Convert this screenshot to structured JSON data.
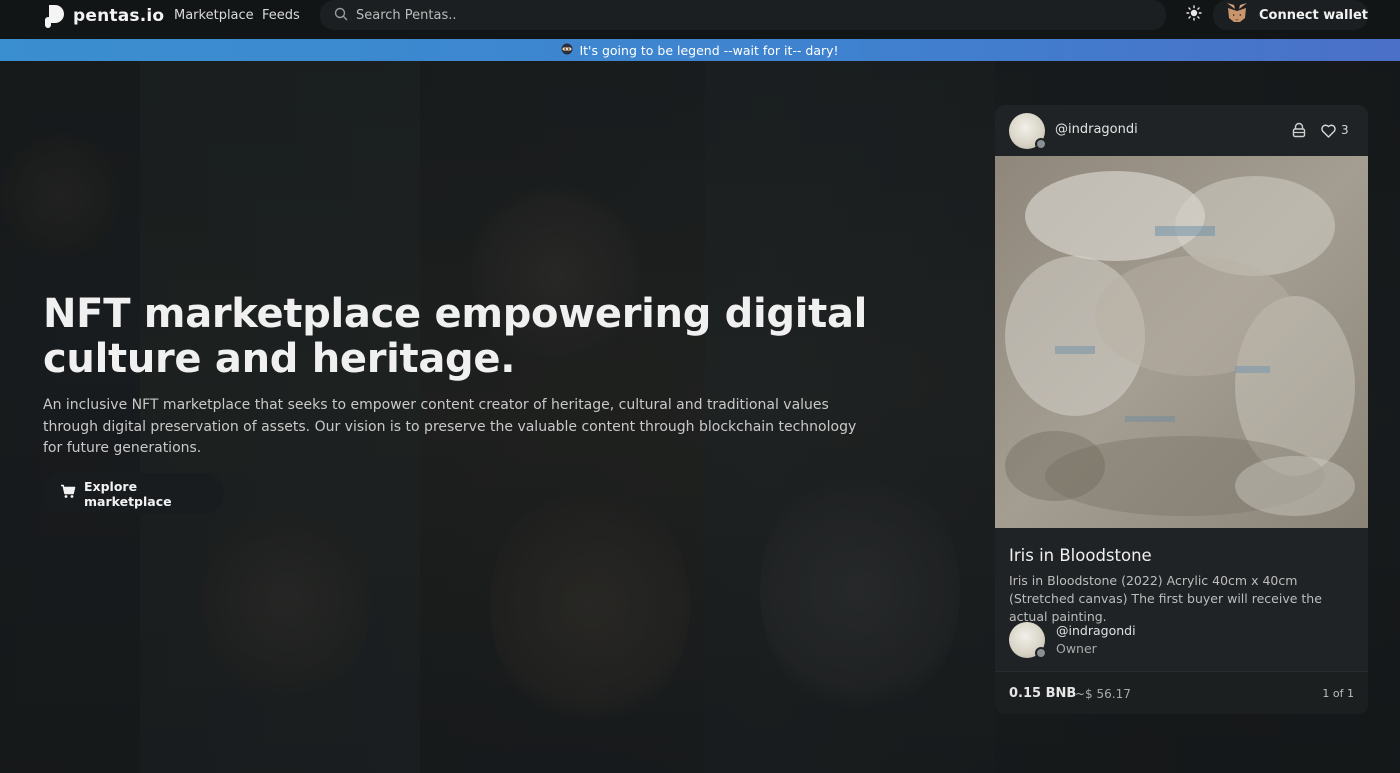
{
  "nav": {
    "brand_name": "pentas.io",
    "links": [
      "Marketplace",
      "Feeds"
    ],
    "search_placeholder": "Search Pentas..",
    "wallet_label": "Connect wallet"
  },
  "banner": {
    "icon": "ninja-emoji",
    "text": "It's going to be legend --wait for it-- dary!"
  },
  "hero": {
    "title": "NFT marketplace empowering digital culture and heritage.",
    "description": "An inclusive NFT marketplace that seeks to empower content creator of heritage, cultural and traditional values through digital preservation of assets. Our vision is to preserve the valuable content through blockchain technology for future generations.",
    "cta_label": "Explore marketplace"
  },
  "nft_card": {
    "creator": "@indragondi",
    "likes": "3",
    "title": "Iris in Bloodstone",
    "description": "Iris in Bloodstone (2022) Acrylic 40cm x 40cm (Stretched canvas) The first buyer will receive the actual painting.",
    "owner_name": "@indragondi",
    "owner_role": "Owner",
    "price": "0.15 BNB",
    "usd_price": "~$ 56.17",
    "edition": "1 of 1"
  },
  "colors": {
    "banner": "#3f88d0",
    "background": "#15191b",
    "card": "#1f2325"
  }
}
